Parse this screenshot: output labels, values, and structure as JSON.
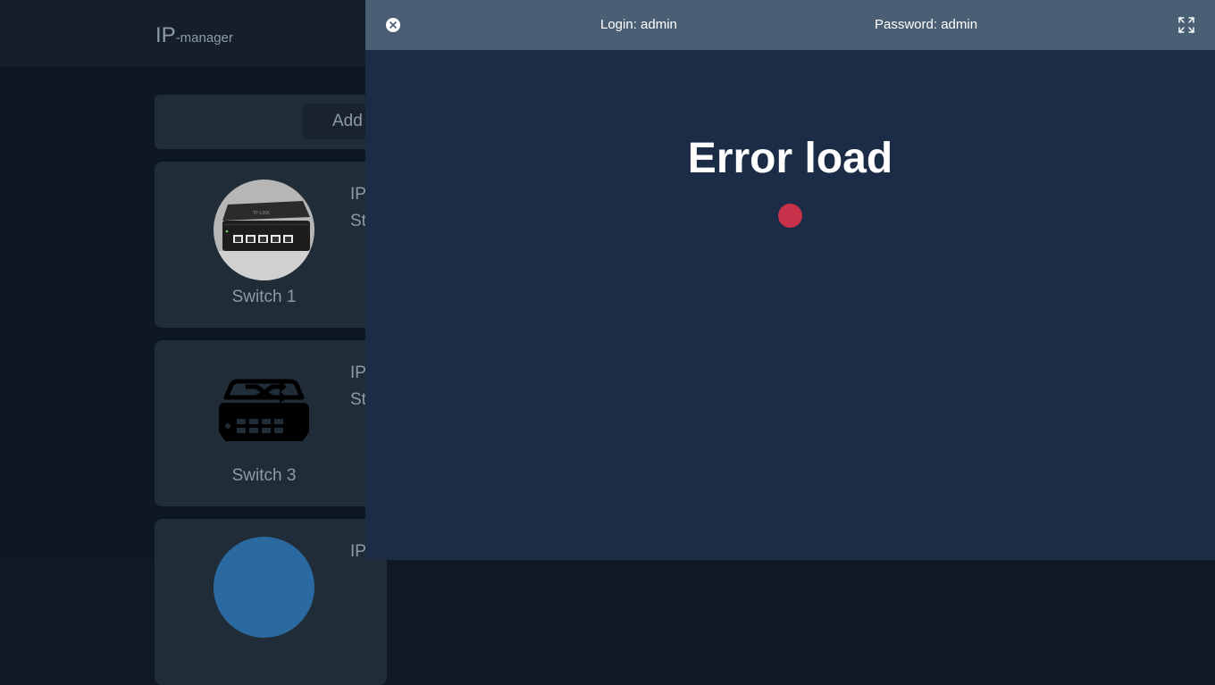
{
  "app": {
    "logo_main": "IP",
    "logo_sub": "-manager"
  },
  "toolbar": {
    "add_label": "Add"
  },
  "devices": [
    {
      "name": "Switch 1",
      "info_line1": "IP",
      "info_line2": "St",
      "icon": "network-switch-photo"
    },
    {
      "name": "Switch 3",
      "info_line1": "IP",
      "info_line2": "St",
      "icon": "network-switch-icon"
    },
    {
      "name": "",
      "info_line1": "IP",
      "info_line2": "",
      "icon": "device-avatar-blue"
    }
  ],
  "modal": {
    "login_text": "Login: admin",
    "password_text": "Password: admin",
    "error_title": "Error load",
    "status_color": "#c8314a",
    "close_icon": "close-icon",
    "fullscreen_icon": "fullscreen-icon"
  }
}
